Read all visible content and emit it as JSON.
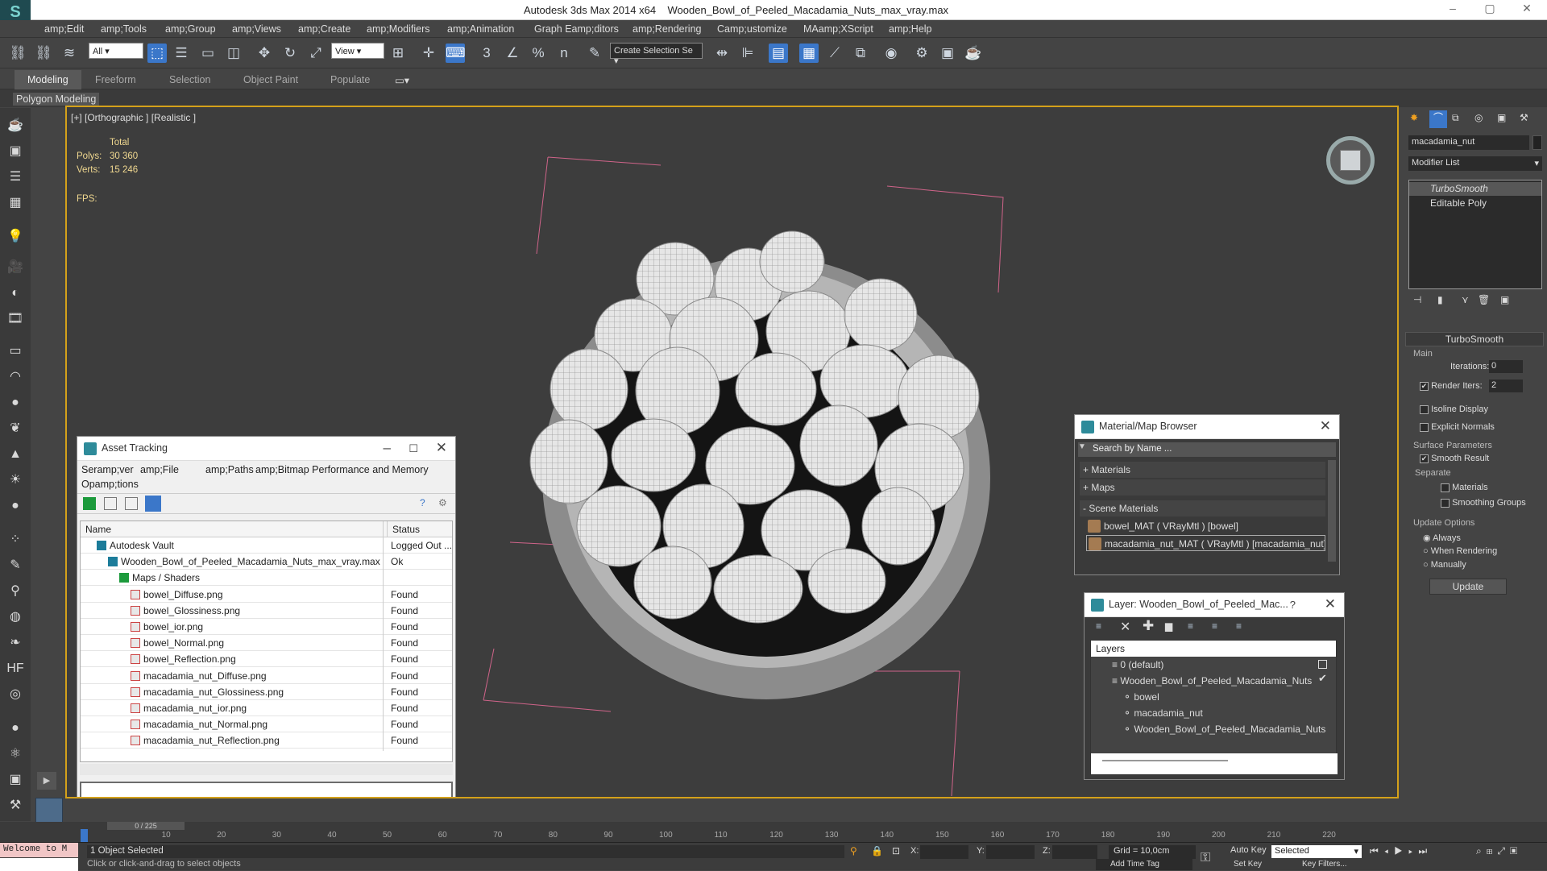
{
  "titlebar": {
    "app": "Autodesk 3ds Max  2014 x64",
    "file": "Wooden_Bowl_of_Peeled_Macadamia_Nuts_max_vray.max",
    "minimize": "–",
    "restore": "▢",
    "close": "✕"
  },
  "menu": [
    "amp;Edit",
    "amp;Tools",
    "amp;Group",
    "amp;Views",
    "amp;Create",
    "amp;Modifiers",
    "amp;Animation",
    "Graph Eamp;ditors",
    "amp;Rendering",
    "Camp;ustomize",
    "MAamp;XScript",
    "amp;Help"
  ],
  "toolbar": {
    "selection_filter": "All",
    "ref_coord": "View",
    "named_selection": "Create Selection Se",
    "snap_labels": [
      "3",
      "%",
      "n"
    ]
  },
  "ribbon": {
    "tabs": [
      "Modeling",
      "Freeform",
      "Selection",
      "Object Paint",
      "Populate"
    ],
    "active": "Modeling",
    "sub": "Polygon Modeling"
  },
  "viewport": {
    "label": "[+] [Orthographic ] [Realistic ]",
    "stats": {
      "total": "Total",
      "polys_label": "Polys:",
      "polys": "30 360",
      "verts_label": "Verts:",
      "verts": "15 246",
      "fps_label": "FPS:"
    }
  },
  "asset_tracking": {
    "title": "Asset Tracking",
    "menu": [
      "Seramp;ver",
      "amp;File",
      "amp;Paths",
      "amp;Bitmap Performance and Memory"
    ],
    "menu2": "Opamp;tions",
    "col_name": "Name",
    "col_status": "Status",
    "rows": [
      {
        "name": "Autodesk Vault",
        "status": "Logged Out ...",
        "indent": 1
      },
      {
        "name": "Wooden_Bowl_of_Peeled_Macadamia_Nuts_max_vray.max",
        "status": "Ok",
        "indent": 2
      },
      {
        "name": "Maps / Shaders",
        "status": "",
        "indent": 3
      },
      {
        "name": "bowel_Diffuse.png",
        "status": "Found",
        "indent": 4
      },
      {
        "name": "bowel_Glossiness.png",
        "status": "Found",
        "indent": 4
      },
      {
        "name": "bowel_ior.png",
        "status": "Found",
        "indent": 4
      },
      {
        "name": "bowel_Normal.png",
        "status": "Found",
        "indent": 4
      },
      {
        "name": "bowel_Reflection.png",
        "status": "Found",
        "indent": 4
      },
      {
        "name": "macadamia_nut_Diffuse.png",
        "status": "Found",
        "indent": 4
      },
      {
        "name": "macadamia_nut_Glossiness.png",
        "status": "Found",
        "indent": 4
      },
      {
        "name": "macadamia_nut_ior.png",
        "status": "Found",
        "indent": 4
      },
      {
        "name": "macadamia_nut_Normal.png",
        "status": "Found",
        "indent": 4
      },
      {
        "name": "macadamia_nut_Reflection.png",
        "status": "Found",
        "indent": 4
      }
    ]
  },
  "material_browser": {
    "title": "Material/Map Browser",
    "search_placeholder": "Search by Name ...",
    "sections": [
      "+ Materials",
      "+ Maps",
      "- Scene Materials"
    ],
    "materials": [
      "bowel_MAT  ( VRayMtl )  [bowel]",
      "macadamia_nut_MAT  ( VRayMtl )  [macadamia_nut]"
    ]
  },
  "layer_window": {
    "title": "Layer: Wooden_Bowl_of_Peeled_Mac...",
    "help": "?",
    "header": "Layers",
    "rows": [
      {
        "name": "0 (default)",
        "indent": 1
      },
      {
        "name": "Wooden_Bowl_of_Peeled_Macadamia_Nuts",
        "indent": 1
      },
      {
        "name": "bowel",
        "indent": 2
      },
      {
        "name": "macadamia_nut",
        "indent": 2
      },
      {
        "name": "Wooden_Bowl_of_Peeled_Macadamia_Nuts",
        "indent": 2
      }
    ]
  },
  "command_panel": {
    "object_name": "macadamia_nut",
    "modifier_list": "Modifier List",
    "stack": [
      "TurboSmooth",
      "Editable Poly"
    ],
    "rollout_title": "TurboSmooth",
    "main_label": "Main",
    "iterations_label": "Iterations:",
    "iterations": "0",
    "render_iters_label": "Render Iters:",
    "render_iters": "2",
    "isoline": "Isoline Display",
    "explicit_normals": "Explicit Normals",
    "surface_params": "Surface Parameters",
    "smooth_result": "Smooth Result",
    "separate": "Separate",
    "materials": "Materials",
    "smoothing_groups": "Smoothing Groups",
    "update_options": "Update Options",
    "always": "Always",
    "when_rendering": "When Rendering",
    "manually": "Manually",
    "update_btn": "Update"
  },
  "timeline": {
    "frame": "0 / 225",
    "ticks": [
      "0",
      "10",
      "20",
      "30",
      "40",
      "50",
      "60",
      "70",
      "80",
      "90",
      "100",
      "110",
      "120",
      "130",
      "140",
      "150",
      "160",
      "170",
      "180",
      "190",
      "200",
      "210",
      "220"
    ]
  },
  "status": {
    "maxscript": "Welcome to M",
    "selected": "1 Object Selected",
    "prompt": "Click or click-and-drag to select objects",
    "x_label": "X:",
    "y_label": "Y:",
    "z_label": "Z:",
    "grid": "Grid = 10,0cm",
    "auto_key": "Auto Key",
    "set_key": "Set Key",
    "key_mode": "Selected",
    "key_filters": "Key Filters...",
    "add_time_tag": "Add Time Tag"
  }
}
